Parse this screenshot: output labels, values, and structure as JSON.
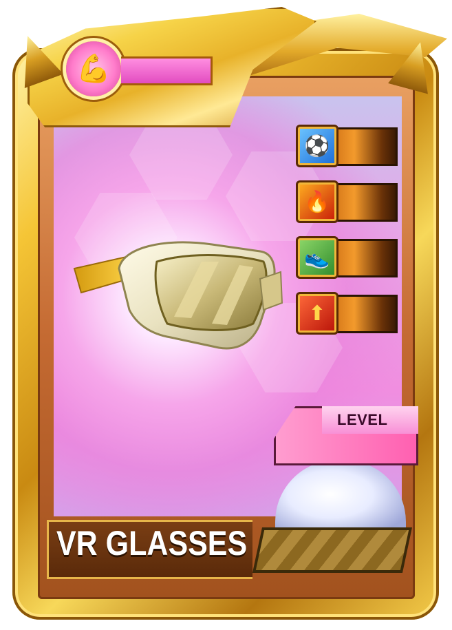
{
  "card": {
    "item_name": "VR GLASSES",
    "level_label": "LEVEL",
    "item_icon": "vr-glasses-icon",
    "power_icon": "flexed-bicep-icon",
    "colors": {
      "frame_gold": "#e8b22a",
      "art_pink": "#f08ee0",
      "power_bar": "#e24cc0",
      "name_plate": "#5a2a0a"
    },
    "skills": [
      {
        "icon": "soccer-ball-icon"
      },
      {
        "icon": "fire-player-icon"
      },
      {
        "icon": "kick-boot-icon"
      },
      {
        "icon": "up-arrow-boost-icon"
      }
    ]
  }
}
